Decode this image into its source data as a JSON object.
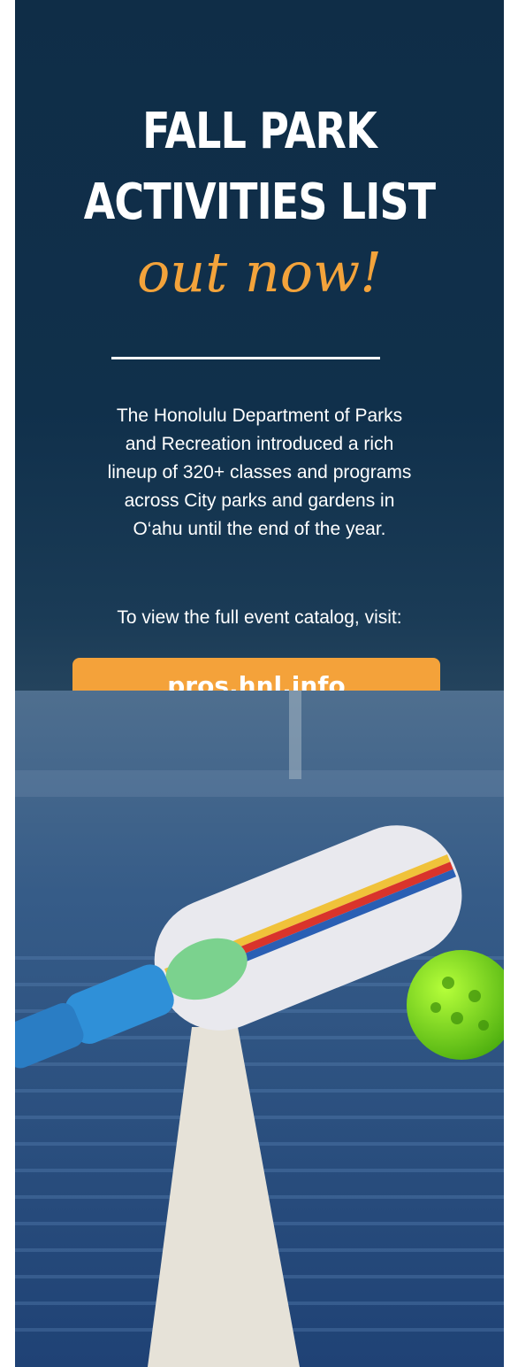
{
  "headline": {
    "line1": "FALL PARK",
    "line2": "ACTIVITIES LIST",
    "script": "out now!"
  },
  "body": {
    "paragraph_lines": [
      "The Honolulu Department of Parks",
      "and Recreation introduced a rich",
      "lineup of 320+ classes and programs",
      "across City parks and gardens in",
      "O‘ahu until the end of the year."
    ],
    "cta_text": "To view the full event catalog, visit:"
  },
  "button": {
    "label": "pros.hnl.info"
  },
  "colors": {
    "background": "#10304b",
    "accent": "#f4a23a",
    "text": "#ffffff"
  }
}
